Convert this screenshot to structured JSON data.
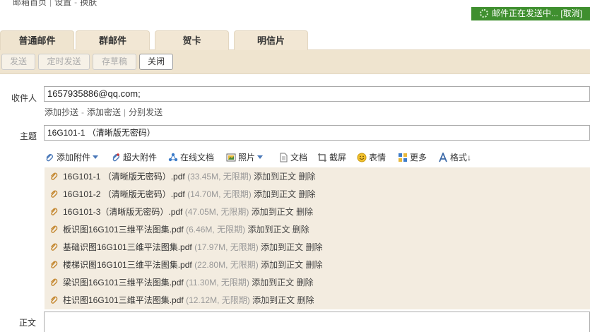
{
  "topnav": {
    "home": "邮箱首页",
    "settings": "设置",
    "skin": "换肤"
  },
  "status": {
    "text": "邮件正在发送中... [取消]"
  },
  "tabs": [
    "普通邮件",
    "群邮件",
    "贺卡",
    "明信片"
  ],
  "toolbar": {
    "send": "发送",
    "scheduled": "定时发送",
    "draft": "存草稿",
    "close": "关闭"
  },
  "compose": {
    "to_label": "收件人",
    "to_value": "1657935886@qq.com;",
    "links": {
      "cc": "添加抄送",
      "bcc": "添加密送",
      "separate": "分别发送"
    },
    "subject_label": "主题",
    "subject_value": "16G101-1 （清晰版无密码）",
    "body_label": "正文"
  },
  "attach_toolbar": {
    "add": "添加附件",
    "large": "超大附件",
    "online": "在线文档",
    "photo": "照片",
    "doc": "文档",
    "screenshot": "截屏",
    "emoji": "表情",
    "more": "更多",
    "format": "格式↓"
  },
  "attachments": [
    {
      "name": "16G101-1 （清晰版无密码）.pdf",
      "meta": "(33.45M, 无限期)",
      "add": "添加到正文",
      "del": "删除"
    },
    {
      "name": "16G101-2 （清晰版无密码）.pdf",
      "meta": "(14.70M, 无限期)",
      "add": "添加到正文",
      "del": "删除"
    },
    {
      "name": "16G101-3（清晰版无密码）.pdf",
      "meta": "(47.05M, 无限期)",
      "add": "添加到正文",
      "del": "删除"
    },
    {
      "name": "板识图16G101三维平法图集.pdf",
      "meta": "(6.46M, 无限期)",
      "add": "添加到正文",
      "del": "删除"
    },
    {
      "name": "基础识图16G101三维平法图集.pdf",
      "meta": "(17.97M, 无限期)",
      "add": "添加到正文",
      "del": "删除"
    },
    {
      "name": "楼梯识图16G101三维平法图集.pdf",
      "meta": "(22.80M, 无限期)",
      "add": "添加到正文",
      "del": "删除"
    },
    {
      "name": "梁识图16G101三维平法图集.pdf",
      "meta": "(11.30M, 无限期)",
      "add": "添加到正文",
      "del": "删除"
    },
    {
      "name": "柱识图16G101三维平法图集.pdf",
      "meta": "(12.12M, 无限期)",
      "add": "添加到正文",
      "del": "删除"
    }
  ],
  "colors": {
    "accent": "#3f8f2f",
    "panel": "#efe4cf",
    "attach_bg": "#f3ece0"
  }
}
